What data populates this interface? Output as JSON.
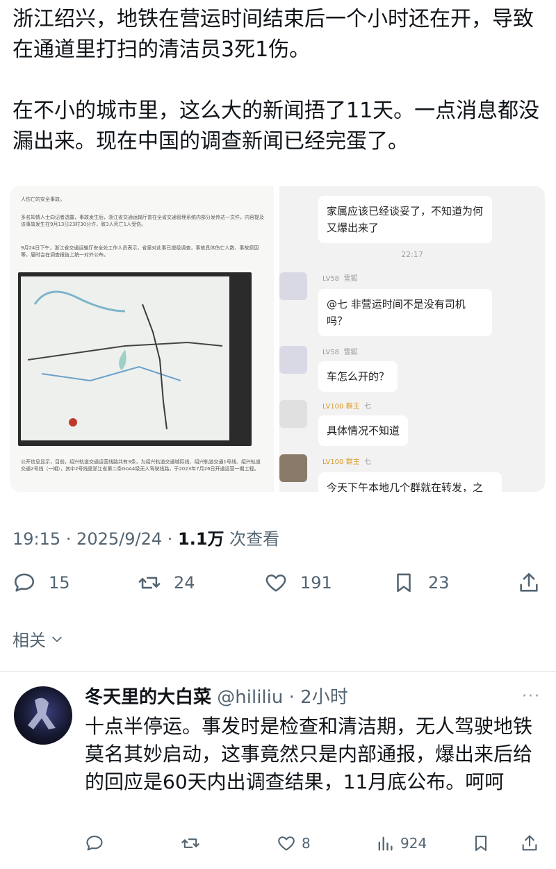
{
  "tweet": {
    "paragraph1": "浙江绍兴，地铁在营运时间结束后一个小时还在开，导致在通道里打扫的清洁员3死1伤。",
    "paragraph2": "在不小的城市里，这么大的新闻捂了11天。一点消息都没漏出来。现在中国的调查新闻已经完蛋了。",
    "time": "19:15 · 2025/9/24 · ",
    "views_count": "1.1万",
    "views_label": " 次查看",
    "replies": "15",
    "retweets": "24",
    "likes": "191",
    "bookmarks": "23"
  },
  "attached_doc": {
    "line1": "人伤亡的安全事故。",
    "line2": "多名知情人士向记者透露，事故发生后，浙江省交通运输厅曾在全省交通管理系统内部分发传达一文件，内容提及该事故发生在9月13日23时30分许，致3人死亡1人受伤。",
    "line3": "9月24日下午，浙江省交通运输厅安全处工作人员表示，省里对此事已提级调查，事故具体伤亡人数、事故原因等，届时会在调查报告上统一对外公布。",
    "line4": "公开信息显示，目前，绍兴轨道交通运营线路共有3条，为绍兴轨道交通城际线、绍兴轨道交通1号线、绍兴轨道交通2号线（一期），其中2号线是浙江省第二条GoA4级无人驾驶线路，于2023年7月26日开通运营一期工程。"
  },
  "attached_chat": {
    "msg1": "家属应该已经谈妥了，不知道为何又爆出来了",
    "time": "22:17",
    "user1_level": "LV58",
    "user1_name": "雪狐",
    "msg2": "@七 非营运时间不是没有司机吗？",
    "user2_level": "LV58",
    "user2_name": "雪狐",
    "msg3": "车怎么开的？",
    "user3_level": "LV100 群主",
    "user3_name": "七",
    "msg4": "具体情况不知道",
    "user4_level": "LV100 群主",
    "user4_name": "七",
    "msg5": "今天下午本地几个群就在转发，之"
  },
  "related_label": "相关",
  "reply": {
    "name": "冬天里的大白菜",
    "handle": " @hililiu · 2小时",
    "more": "···",
    "text": "十点半停运。事发时是检查和清洁期，无人驾驶地铁莫名其妙启动，这事竟然只是内部通报，爆出来后给的回应是60天内出调查结果，11月底公布。呵呵",
    "likes": "8",
    "views": "924"
  },
  "icons": {
    "reply": "reply-icon",
    "retweet": "retweet-icon",
    "like": "heart-icon",
    "bookmark": "bookmark-icon",
    "share": "share-icon",
    "views": "views-icon",
    "chevron": "chevron-down-icon"
  },
  "colors": {
    "text": "#0f1419",
    "muted": "#536471",
    "divider": "#e6e9eb"
  }
}
